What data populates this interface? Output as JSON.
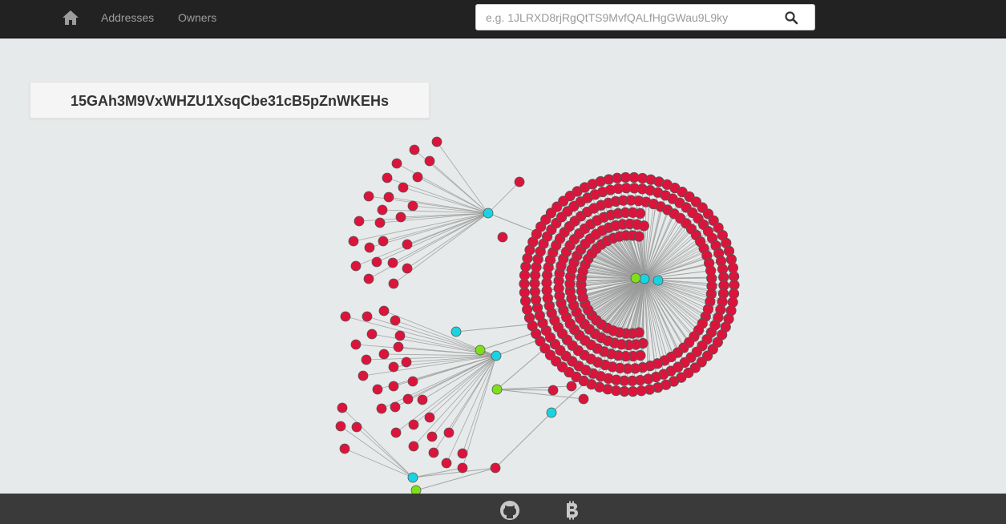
{
  "nav": {
    "home_icon": "home-icon",
    "links": [
      "Addresses",
      "Owners"
    ]
  },
  "search": {
    "placeholder": "e.g. 1JLRXD8rjRgQtTS9MvfQALfHgGWau9L9ky",
    "value": "",
    "icon": "search-icon"
  },
  "address": {
    "title": "15GAh3M9VxWHZU1XsqCbe31cB5pZnWKEHs"
  },
  "graph": {
    "colors": {
      "address_node": "#dc143c",
      "cyan_node": "#1bd3e0",
      "green_node": "#7fe01a",
      "edge": "#9a9a9a",
      "node_stroke": "#555555"
    }
  },
  "footer": {
    "icons": [
      "github-icon",
      "bitcoin-icon"
    ]
  }
}
